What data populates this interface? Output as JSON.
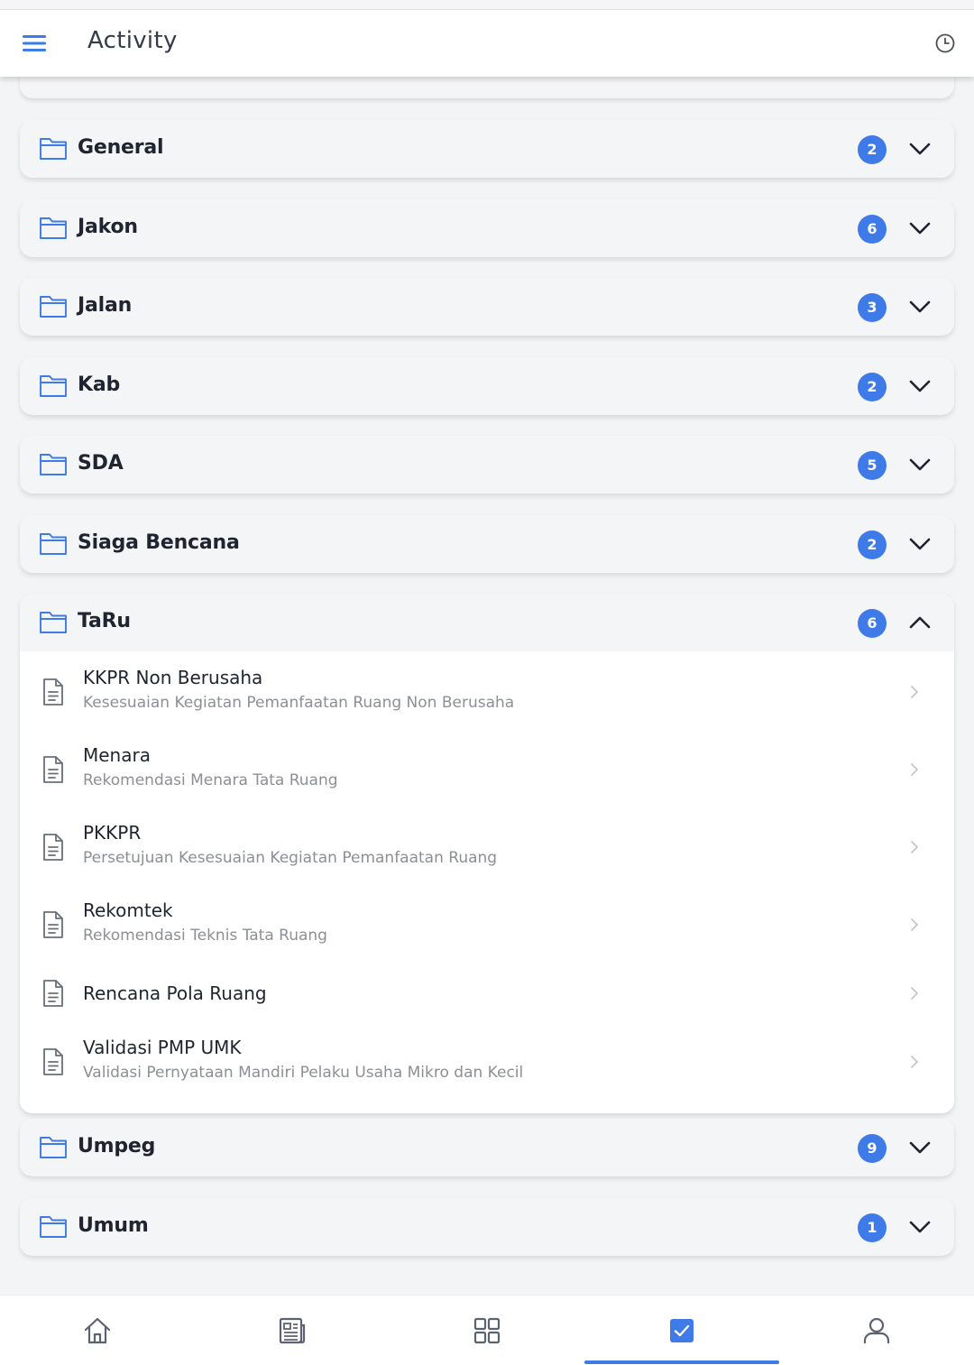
{
  "app_bar": {
    "title": "Activity",
    "menu_icon": "menu-icon",
    "history_icon": "history-icon"
  },
  "colors": {
    "accent": "#3e7ae8",
    "badge_text": "#ffffff",
    "card_bg": "#f4f5f7",
    "subtitle": "#8c8f96"
  },
  "categories": [
    {
      "name": "General",
      "count": "2",
      "expanded": false
    },
    {
      "name": "Jakon",
      "count": "6",
      "expanded": false
    },
    {
      "name": "Jalan",
      "count": "3",
      "expanded": false
    },
    {
      "name": "Kab",
      "count": "2",
      "expanded": false
    },
    {
      "name": "SDA",
      "count": "5",
      "expanded": false
    },
    {
      "name": "Siaga Bencana",
      "count": "2",
      "expanded": false
    },
    {
      "name": "TaRu",
      "count": "6",
      "expanded": true,
      "items": [
        {
          "title": "KKPR Non Berusaha",
          "subtitle": "Kesesuaian Kegiatan Pemanfaatan Ruang Non Berusaha"
        },
        {
          "title": "Menara",
          "subtitle": "Rekomendasi Menara Tata Ruang"
        },
        {
          "title": "PKKPR",
          "subtitle": "Persetujuan Kesesuaian Kegiatan Pemanfaatan Ruang"
        },
        {
          "title": "Rekomtek",
          "subtitle": "Rekomendasi Teknis Tata Ruang"
        },
        {
          "title": "Rencana Pola Ruang",
          "subtitle": ""
        },
        {
          "title": "Validasi PMP UMK",
          "subtitle": "Validasi Pernyataan Mandiri Pelaku Usaha Mikro dan Kecil"
        }
      ]
    },
    {
      "name": "Umpeg",
      "count": "9",
      "expanded": false
    },
    {
      "name": "Umum",
      "count": "1",
      "expanded": false
    }
  ],
  "bottom_nav": {
    "items": [
      "home-icon",
      "news-icon",
      "grid-icon",
      "activity-check-icon",
      "profile-icon"
    ],
    "active_index": 3
  }
}
